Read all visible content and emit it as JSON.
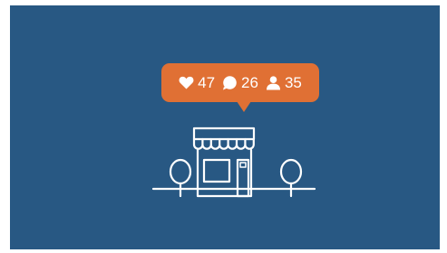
{
  "colors": {
    "background": "#285883",
    "badge": "#e07034",
    "line_art": "#ffffff"
  },
  "badge": {
    "likes": "47",
    "comments": "26",
    "followers": "35",
    "icons": [
      "heart-icon",
      "comment-icon",
      "person-icon"
    ]
  },
  "illustration": {
    "subject": "storefront-icon",
    "elements": [
      "awning",
      "shop-window",
      "door",
      "tree-left",
      "tree-right",
      "ground-line"
    ]
  }
}
